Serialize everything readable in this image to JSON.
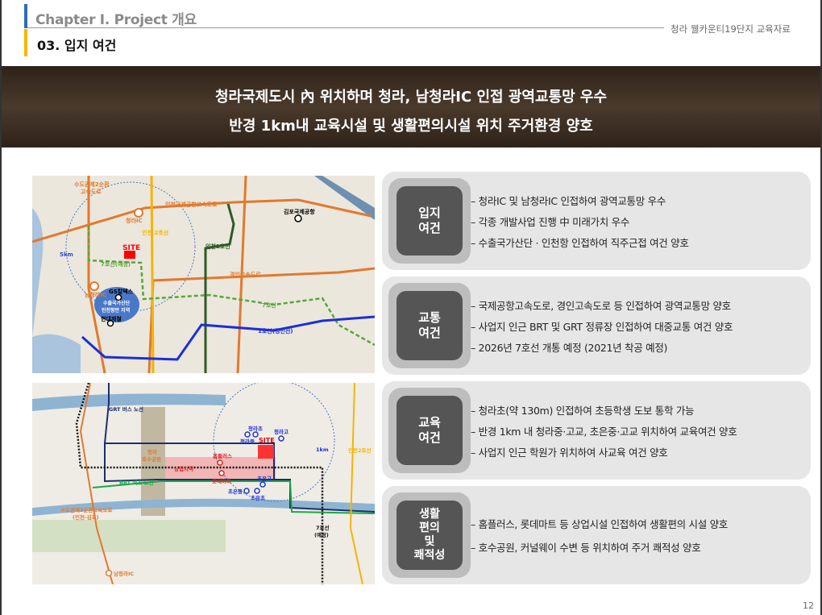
{
  "header": {
    "chapter": "Chapter Ⅰ. Project 개요",
    "section": "03. 입지 여건",
    "doc_label": "청라 웰카운티19단지 교육자료"
  },
  "banner": {
    "line1": "청라국제도시 內 위치하며 청라, 남청라IC 인접 광역교통망 우수",
    "line2": "반경 1km내 교육시설 및 생활편의시설 위치 주거환경 양호"
  },
  "map1": {
    "labels": {
      "ring2": "수도권제2순환",
      "ring2b": "고속도로",
      "airport_hwy": "인천국제공항고속도로",
      "cheongna_ic": "청라IC",
      "incheon2": "인천 2호선",
      "site": "SITE",
      "gimpo": "김포국제공항",
      "incheon1": "인천1호선",
      "radius": "5km",
      "line7_plan": "7호선(예정)",
      "gyeongin": "경인고속도로",
      "namcheongna_ic": "남청라IC",
      "gs": "GS칼텍스",
      "industrial": "수출국가산단",
      "industrial2": "인천항만 지역",
      "hyundai": "현대제철",
      "line7": "7호선",
      "line1": "1호선(경인선)"
    }
  },
  "map2": {
    "labels": {
      "grt": "GRT 버스 노선",
      "lake": "청라",
      "lake2": "호수공원",
      "school1": "청라초",
      "school2": "청라중",
      "school3": "청라고",
      "site": "SITE",
      "radius": "1km",
      "incheon2": "인천2호선",
      "homeplus": "홈플러스",
      "commercial": "상업지역",
      "lotte": "롯데마트",
      "brt": "BRT 버스 노선",
      "choeun_h": "초은고",
      "choeun_m": "초은중",
      "choeun_e": "초은초",
      "ring2": "수도권제2순환고속도로",
      "ring2b": "(인천-김포)",
      "line7": "7호선",
      "line7b": "(예정)",
      "namcheongna_ic": "남청라IC"
    }
  },
  "cards": [
    {
      "title": "입지\n여건",
      "items": [
        "– 청라IC 및 남청라IC 인접하여 광역교통망 우수",
        "– 각종 개발사업 진행 中 미래가치 우수",
        "– 수출국가산단 · 인천항 인접하여 직주근접 여건 양호"
      ]
    },
    {
      "title": "교통\n여건",
      "items": [
        "– 국제공항고속도로, 경인고속도로 등 인접하여 광역교통망 양호",
        "– 사업지 인근 BRT 및 GRT 정류장 인접하여 대중교통 여건 양호",
        "– 2026년 7호선 개통 예정 (2021년 착공 예정)"
      ]
    },
    {
      "title": "교육\n여건",
      "items": [
        "– 청라초(약 130m) 인접하여 초등학생 도보 통학 가능",
        "– 반경 1km 내 청라중·고교, 초은중·고교 위치하여 교육여건 양호",
        "– 사업지 인근 학원가 위치하여 사교육 여건 양호"
      ]
    },
    {
      "title": "생활\n편의\n및\n쾌적성",
      "items": [
        "–  홈플러스, 롯데마트 등 상업시설 인접하여 생활편의 시설 양호",
        "–  호수공원, 커널웨이 수변 등  위치하여 주거 쾌적성 양호"
      ]
    }
  ],
  "page_number": "12"
}
